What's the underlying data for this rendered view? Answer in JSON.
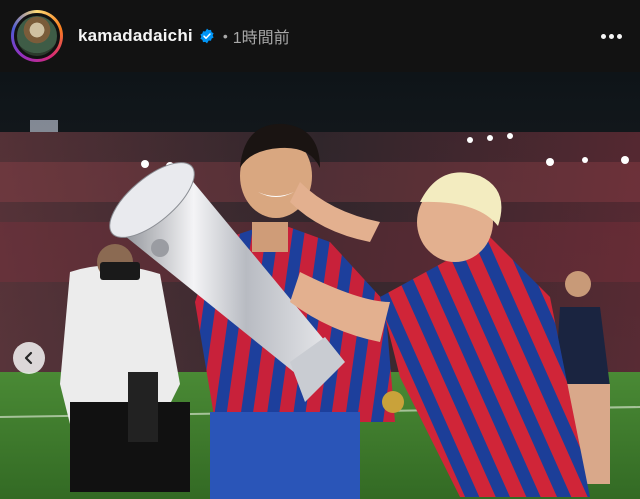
{
  "post": {
    "username": "kamadadaichi",
    "separator": "•",
    "time_ago": "1時間前"
  },
  "icons": {
    "verified": "verified-badge-icon",
    "more": "more-options-icon",
    "prev": "chevron-left-icon"
  },
  "colors": {
    "header_bg": "#121212",
    "verified_blue": "#0095f6",
    "jersey_red": "#d2243a",
    "jersey_blue": "#1b3e9b",
    "pitch_green": "#3f7a2e"
  }
}
